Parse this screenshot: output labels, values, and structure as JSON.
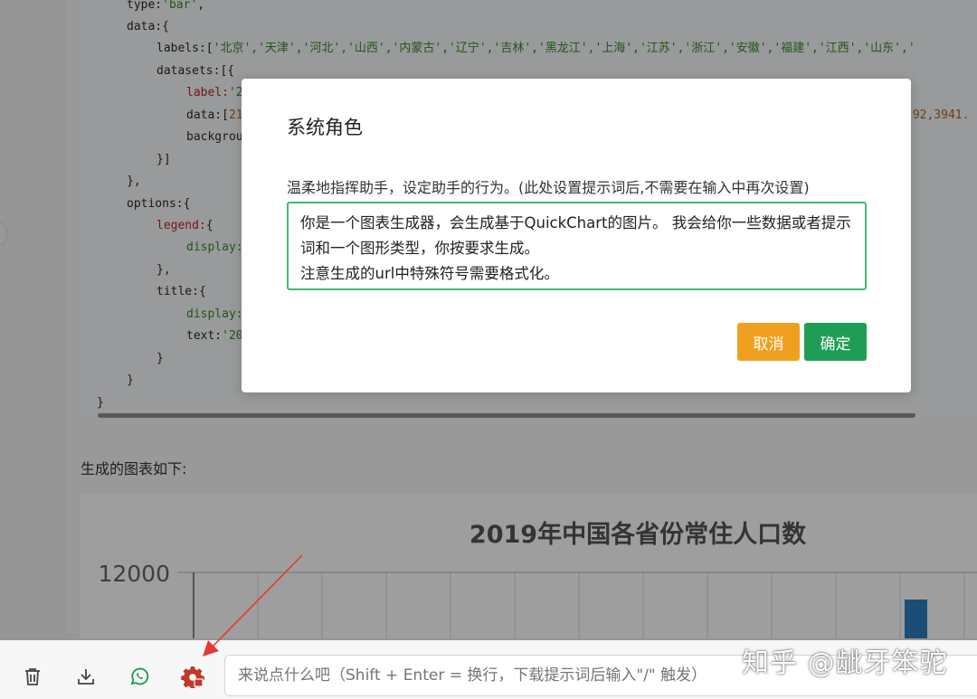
{
  "code": {
    "line_type": {
      "key": "type:",
      "value": "'bar'",
      "tail": ","
    },
    "line_data": "data:{",
    "line_labels_key": "labels:[",
    "line_labels_value": "'北京','天津','河北','山西','内蒙古','辽宁','吉林','黑龙江','上海','江苏','浙江','安徽','福建','江西','山东','",
    "line_datasets": "datasets:[{",
    "line_label_key": "label:",
    "line_label_value": "'2",
    "line_data_key": "data:[",
    "line_data_value_start": "21",
    "line_data_value_visible": ".92,3941.",
    "line_background": "backgrou",
    "line_close_bracket": "}]",
    "line_close_brace_comma": "},",
    "line_options": "options:{",
    "line_legend_key": "legend:",
    "line_legend_tail": "{",
    "line_display1": "display:",
    "line_close_brace_comma2": "},",
    "line_title": "title:{",
    "line_display2": "display:",
    "line_text_key": "text:",
    "line_text_value": "'20",
    "line_close_inner": "}",
    "line_close_outer": "}",
    "line_close_root": "}"
  },
  "chart_caption": "生成的图表如下:",
  "chart_data": {
    "type": "bar",
    "title": "2019年中国各省份常住人口数",
    "y_tick_visible": "12000",
    "categories": [
      "北京",
      "天津",
      "河北",
      "山西",
      "内蒙古",
      "辽宁",
      "吉林",
      "黑龙江",
      "上海",
      "江苏",
      "浙江",
      "安徽",
      "福建",
      "江西",
      "山东"
    ],
    "visible_bar": {
      "index": 11,
      "color": "#2a7fc0"
    }
  },
  "dialog": {
    "title": "系统角色",
    "description": "温柔地指挥助手，设定助手的行为。(此处设置提示词后,不需要在输入中再次设置)",
    "prompt_text": "你是一个图表生成器，会生成基于QuickChart的图片。 我会给你一些数据或者提示词和一个图形类型，你按要求生成。\n注意生成的url中特殊符号需要格式化。",
    "cancel_label": "取消",
    "confirm_label": "确定"
  },
  "toolbar": {
    "icons": [
      "trash-icon",
      "download-icon",
      "whatsapp-icon",
      "settings-gear-icon"
    ],
    "input_placeholder": "来说点什么吧（Shift + Enter = 换行，下载提示词后输入\"/\" 触发）"
  },
  "watermark": "知乎 @龇牙笨驼",
  "colors": {
    "accent_green": "#1f9d55",
    "cancel_orange": "#f0a020",
    "settings_red": "#c0392b",
    "annotation_red": "#e53935"
  }
}
